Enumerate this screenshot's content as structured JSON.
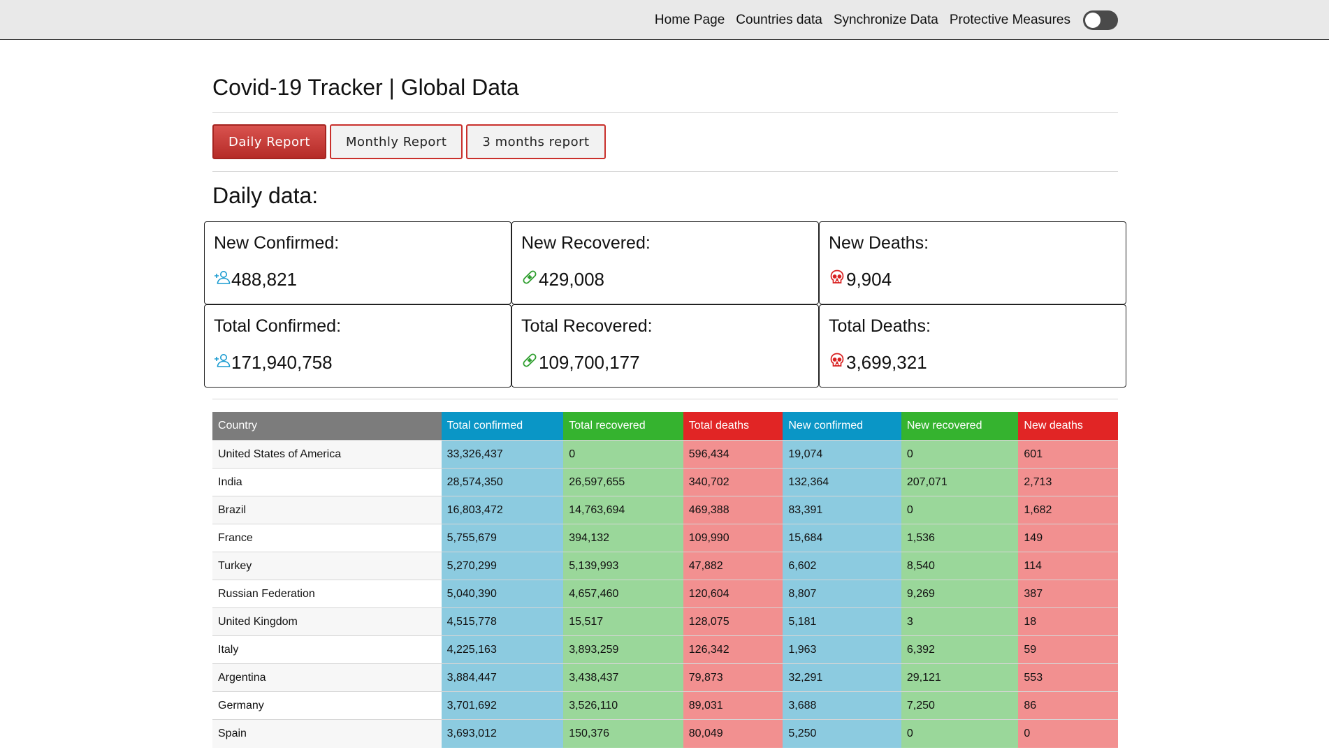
{
  "nav": {
    "links": [
      "Home Page",
      "Countries data",
      "Synchronize Data",
      "Protective Measures"
    ],
    "toggle_on": false
  },
  "page": {
    "title": "Covid-19 Tracker | Global Data",
    "tabs": [
      "Daily Report",
      "Monthly Report",
      "3 months report"
    ],
    "active_tab": 0,
    "section_title": "Daily data:"
  },
  "cards": [
    {
      "label": "New Confirmed:",
      "value": "488,821",
      "icon": "user-plus-icon",
      "color": "#1a9bd0"
    },
    {
      "label": "New Recovered:",
      "value": "429,008",
      "icon": "bandage-icon",
      "color": "#2e9e2e"
    },
    {
      "label": "New Deaths:",
      "value": "9,904",
      "icon": "skull-icon",
      "color": "#d92020"
    },
    {
      "label": "Total Confirmed:",
      "value": "171,940,758",
      "icon": "user-plus-icon",
      "color": "#1a9bd0"
    },
    {
      "label": "Total Recovered:",
      "value": "109,700,177",
      "icon": "bandage-icon",
      "color": "#2e9e2e"
    },
    {
      "label": "Total Deaths:",
      "value": "3,699,321",
      "icon": "skull-icon",
      "color": "#d92020"
    }
  ],
  "table": {
    "headers": [
      "Country",
      "Total confirmed",
      "Total recovered",
      "Total deaths",
      "New confirmed",
      "New recovered",
      "New deaths"
    ],
    "rows": [
      [
        "United States of America",
        "33,326,437",
        "0",
        "596,434",
        "19,074",
        "0",
        "601"
      ],
      [
        "India",
        "28,574,350",
        "26,597,655",
        "340,702",
        "132,364",
        "207,071",
        "2,713"
      ],
      [
        "Brazil",
        "16,803,472",
        "14,763,694",
        "469,388",
        "83,391",
        "0",
        "1,682"
      ],
      [
        "France",
        "5,755,679",
        "394,132",
        "109,990",
        "15,684",
        "1,536",
        "149"
      ],
      [
        "Turkey",
        "5,270,299",
        "5,139,993",
        "47,882",
        "6,602",
        "8,540",
        "114"
      ],
      [
        "Russian Federation",
        "5,040,390",
        "4,657,460",
        "120,604",
        "8,807",
        "9,269",
        "387"
      ],
      [
        "United Kingdom",
        "4,515,778",
        "15,517",
        "128,075",
        "5,181",
        "3",
        "18"
      ],
      [
        "Italy",
        "4,225,163",
        "3,893,259",
        "126,342",
        "1,963",
        "6,392",
        "59"
      ],
      [
        "Argentina",
        "3,884,447",
        "3,438,437",
        "79,873",
        "32,291",
        "29,121",
        "553"
      ],
      [
        "Germany",
        "3,701,692",
        "3,526,110",
        "89,031",
        "3,688",
        "7,250",
        "86"
      ],
      [
        "Spain",
        "3,693,012",
        "150,376",
        "80,049",
        "5,250",
        "0",
        "0"
      ]
    ]
  }
}
